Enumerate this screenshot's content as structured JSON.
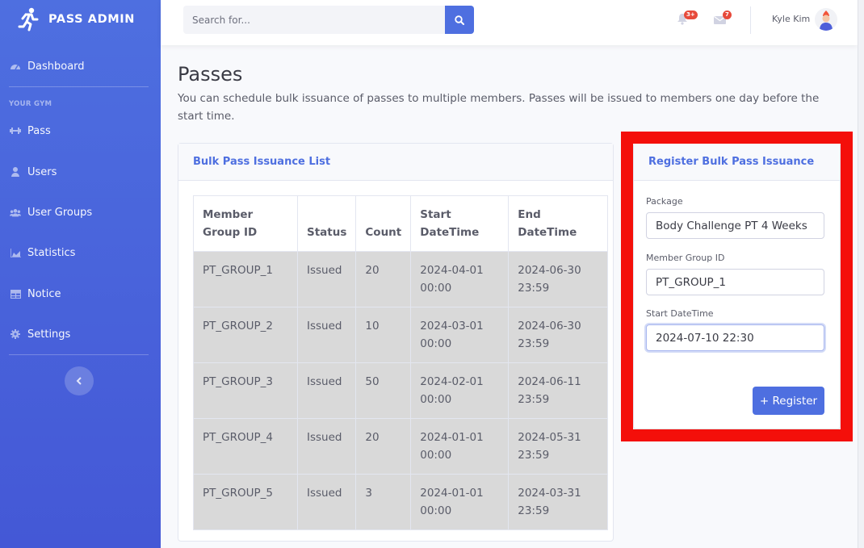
{
  "brand": {
    "name": "PASS ADMIN"
  },
  "sidebar": {
    "dashboard_label": "Dashboard",
    "section_heading": "YOUR GYM",
    "items": [
      {
        "label": "Pass"
      },
      {
        "label": "Users"
      },
      {
        "label": "User Groups"
      },
      {
        "label": "Statistics"
      },
      {
        "label": "Notice"
      },
      {
        "label": "Settings"
      }
    ]
  },
  "topbar": {
    "search_placeholder": "Search for...",
    "alerts_badge": "3+",
    "messages_badge": "7",
    "user_name": "Kyle Kim"
  },
  "page": {
    "title": "Passes",
    "description": "You can schedule bulk issuance of passes to multiple members. Passes will be issued to members one day before the start time."
  },
  "list_card": {
    "title": "Bulk Pass Issuance List",
    "columns": [
      "Member Group ID",
      "Status",
      "Count",
      "Start DateTime",
      "End DateTime"
    ],
    "rows": [
      {
        "group_id": "PT_GROUP_1",
        "status": "Issued",
        "count": "20",
        "start": "2024-04-01 00:00",
        "end": "2024-06-30 23:59"
      },
      {
        "group_id": "PT_GROUP_2",
        "status": "Issued",
        "count": "10",
        "start": "2024-03-01 00:00",
        "end": "2024-06-30 23:59"
      },
      {
        "group_id": "PT_GROUP_3",
        "status": "Issued",
        "count": "50",
        "start": "2024-02-01 00:00",
        "end": "2024-06-11 23:59"
      },
      {
        "group_id": "PT_GROUP_4",
        "status": "Issued",
        "count": "20",
        "start": "2024-01-01 00:00",
        "end": "2024-05-31 23:59"
      },
      {
        "group_id": "PT_GROUP_5",
        "status": "Issued",
        "count": "3",
        "start": "2024-01-01 00:00",
        "end": "2024-03-31 23:59"
      }
    ]
  },
  "register_card": {
    "title": "Register Bulk Pass Issuance",
    "package_label": "Package",
    "package_value": "Body Challenge PT 4 Weeks",
    "group_label": "Member Group ID",
    "group_value": "PT_GROUP_1",
    "start_label": "Start DateTime",
    "start_value": "2024-07-10 22:30",
    "register_button": "+ Register"
  },
  "colors": {
    "primary": "#4e6fe0",
    "highlight": "#f40f0a",
    "badge": "#e74a3b"
  },
  "icons": [
    "running-person-icon",
    "dashboard-icon",
    "dumbbell-icon",
    "user-icon",
    "users-icon",
    "chart-area-icon",
    "table-icon",
    "gear-icon",
    "chevron-left-icon",
    "search-icon",
    "bell-icon",
    "envelope-icon"
  ]
}
